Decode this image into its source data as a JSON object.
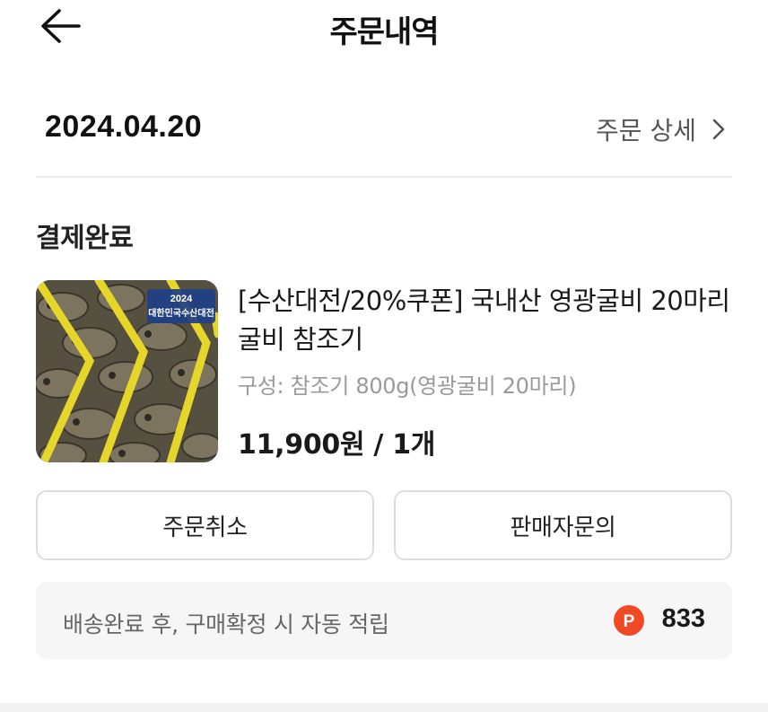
{
  "header": {
    "title": "주문내역",
    "back_icon": "arrow-left-icon"
  },
  "order": {
    "date": "2024.04.20",
    "detail_link": "주문 상세",
    "detail_icon": "chevron-right-icon",
    "status": "결제완료"
  },
  "product": {
    "name": "[수산대전/20%쿠폰] 국내산 영광굴비 20마리 굴비 참조기",
    "option": "구성: 참조기 800g(영광굴비 20마리)",
    "price": "11,900원 / 1개",
    "thumb_banner_year": "2024",
    "thumb_banner_text": "대한민국수산대전"
  },
  "actions": {
    "cancel_label": "주문취소",
    "inquiry_label": "판매자문의"
  },
  "points": {
    "notice": "배송완료 후, 구매확정 시 자동 적립",
    "badge_letter": "P",
    "value": "833",
    "badge_color": "#ef4a23"
  }
}
